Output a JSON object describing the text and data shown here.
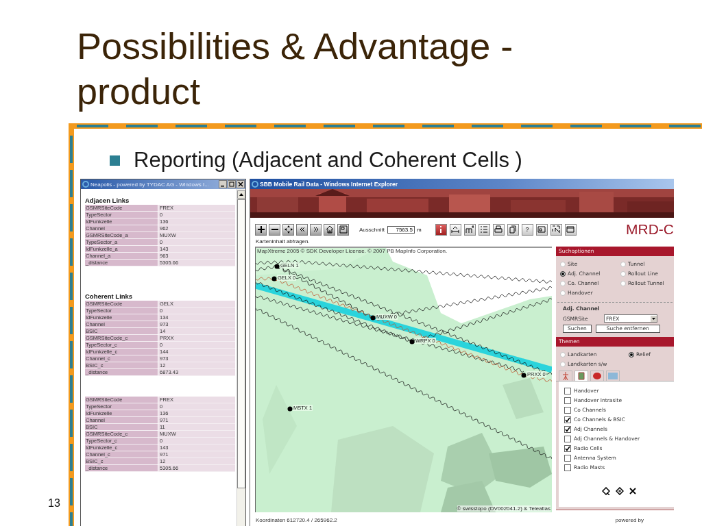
{
  "slide": {
    "title_lines": [
      "Possibilities & Advantage -",
      "product"
    ],
    "bullet": "Reporting (Adjacent and Coherent Cells )",
    "page_number": "13"
  },
  "report_window": {
    "title": "Neapolis - powered by TYDAC AG - Windows I...",
    "sections": [
      {
        "heading": "Adjacen Links",
        "rows": [
          [
            "GSMRSiteCode",
            "FREX"
          ],
          [
            "TypeSector",
            "0"
          ],
          [
            "IdFunkzelle",
            "136"
          ],
          [
            "Channel",
            "962"
          ],
          [
            "GSMRSiteCode_a",
            "MUXW"
          ],
          [
            "TypeSector_a",
            "0"
          ],
          [
            "IdFunkzelle_a",
            "143"
          ],
          [
            "Channel_a",
            "963"
          ],
          [
            "_distance",
            "5305.66"
          ]
        ]
      },
      {
        "heading": "Coherent Links",
        "rows": [
          [
            "GSMRSiteCode",
            "GELX"
          ],
          [
            "TypeSector",
            "0"
          ],
          [
            "IdFunkzelle",
            "134"
          ],
          [
            "Channel",
            "973"
          ],
          [
            "BSIC",
            "14"
          ],
          [
            "GSMRSiteCode_c",
            "PRXX"
          ],
          [
            "TypeSector_c",
            "0"
          ],
          [
            "IdFunkzelle_c",
            "144"
          ],
          [
            "Channel_c",
            "973"
          ],
          [
            "BSIC_c",
            "12"
          ],
          [
            "_distance",
            "6873.43"
          ]
        ]
      },
      {
        "rows": [
          [
            "GSMRSiteCode",
            "FREX"
          ],
          [
            "TypeSector",
            "0"
          ],
          [
            "IdFunkzelle",
            "136"
          ],
          [
            "Channel",
            "971"
          ],
          [
            "BSIC",
            "11"
          ],
          [
            "GSMRSiteCode_c",
            "MUXW"
          ],
          [
            "TypeSector_c",
            "0"
          ],
          [
            "IdFunkzelle_c",
            "143"
          ],
          [
            "Channel_c",
            "971"
          ],
          [
            "BSIC_c",
            "12"
          ],
          [
            "_distance",
            "5305.66"
          ]
        ]
      }
    ]
  },
  "browser": {
    "title": "SBB Mobile Rail Data - Windows Internet Explorer",
    "toolbar": {
      "scale_label": "Ausschnitt",
      "scale_value": "7563.5",
      "scale_unit": "m",
      "help": "?"
    },
    "logo": "MRD-C",
    "hint": "Karteninhalt abfragen.",
    "map": {
      "license": "MapXtreme 2005 © SDK Developer License. © 2007 PB MapInfo Corporation.",
      "copyright": "© swisstopo (DV002041.2) & Teleatlas",
      "sites": [
        {
          "label": "GELN 1"
        },
        {
          "label": "GELX 0"
        },
        {
          "label": "MUXW 0"
        },
        {
          "label": "WRPX 0"
        },
        {
          "label": "PRXX 0"
        },
        {
          "label": "MSTX 1"
        }
      ]
    },
    "search": {
      "title": "Suchoptionen",
      "options": [
        {
          "label": "Site",
          "selected": false
        },
        {
          "label": "Tunnel",
          "selected": false
        },
        {
          "label": "Adj. Channel",
          "selected": true
        },
        {
          "label": "Rollout Line",
          "selected": false
        },
        {
          "label": "Co. Channel",
          "selected": false
        },
        {
          "label": "Rollout Tunnel",
          "selected": false
        },
        {
          "label": "Handover",
          "selected": false
        }
      ],
      "detail_title": "Adj. Channel",
      "site_label": "GSMRSite",
      "site_value": "FREX",
      "buttons": [
        "Suchen",
        "Suche entfernen"
      ]
    },
    "themes": {
      "title": "Themen",
      "options": [
        {
          "label": "Landkarten",
          "selected": false
        },
        {
          "label": "Relief",
          "selected": true
        },
        {
          "label": "Landkarten s/w",
          "selected": false
        }
      ],
      "tabs": [
        {
          "selected": false
        },
        {
          "selected": true
        },
        {
          "selected": false
        },
        {
          "selected": false
        }
      ],
      "layers": [
        {
          "label": "Handover",
          "checked": false
        },
        {
          "label": "Handover Intrasite",
          "checked": false
        },
        {
          "label": "Co Channels",
          "checked": false
        },
        {
          "label": "Co Channels & BSIC",
          "checked": true
        },
        {
          "label": "Adj Channels",
          "checked": true
        },
        {
          "label": "Adj Channels & Handover",
          "checked": false
        },
        {
          "label": "Radio Cells",
          "checked": true
        },
        {
          "label": "Antenna System",
          "checked": false
        },
        {
          "label": "Radio Masts",
          "checked": false
        }
      ]
    },
    "coordinates": "Koordinaten 612720.4 / 265962.2",
    "powered_by": "powered by"
  }
}
